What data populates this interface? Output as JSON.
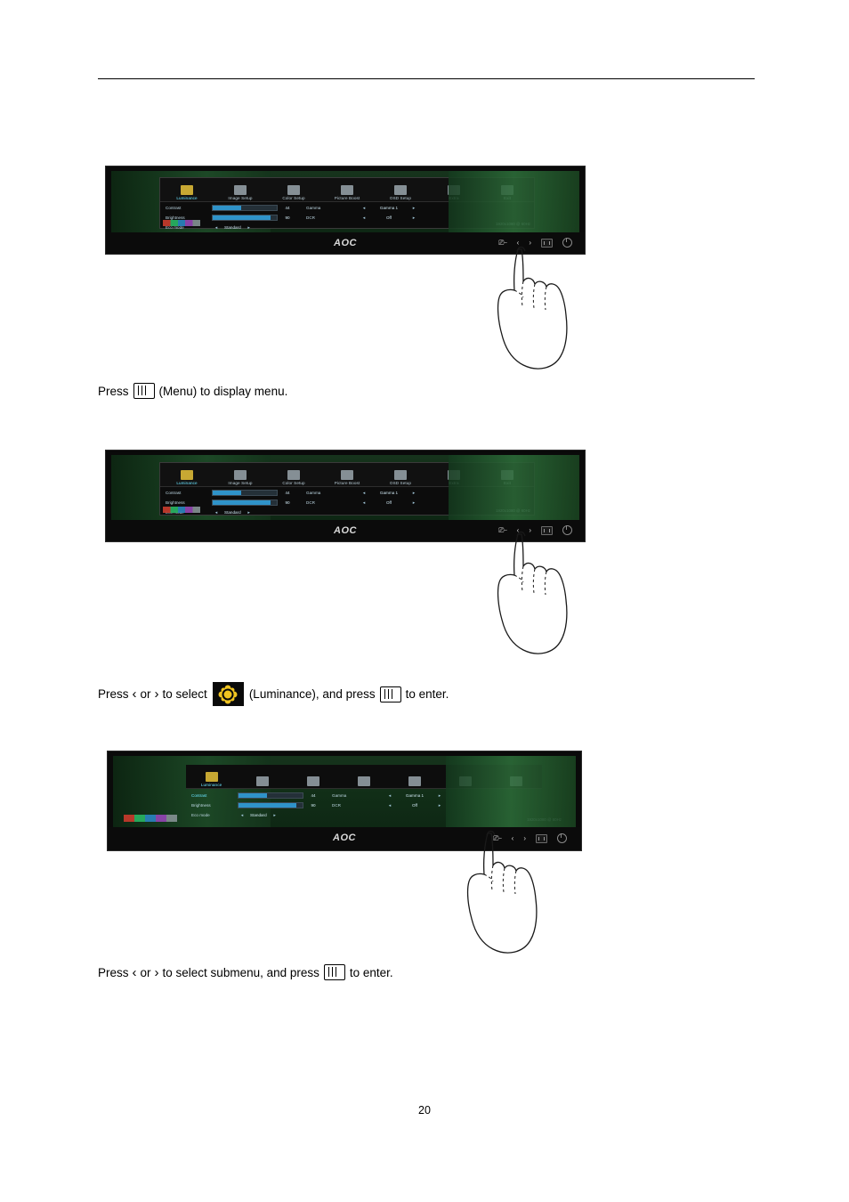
{
  "page": {
    "number": "20"
  },
  "osd": {
    "tabs": [
      {
        "label": "Luminance",
        "icon": "brightness-icon"
      },
      {
        "label": "Image Setup",
        "icon": "image-setup-icon"
      },
      {
        "label": "Color Setup",
        "icon": "color-setup-icon"
      },
      {
        "label": "Picture Boost",
        "icon": "picture-boost-icon"
      },
      {
        "label": "OSD Setup",
        "icon": "osd-setup-icon"
      },
      {
        "label": "Extra",
        "icon": "extra-icon"
      },
      {
        "label": "Exit",
        "icon": "exit-icon"
      }
    ],
    "rows": [
      {
        "name": "Contrast",
        "value": "44",
        "bar": 44,
        "name2": "Gamma",
        "option": "Gamma 1"
      },
      {
        "name": "Brightness",
        "value": "90",
        "bar": 90,
        "name2": "DCR",
        "option": "Off"
      }
    ],
    "eco": {
      "name": "Eco mode",
      "value": "Standard"
    },
    "resolution": "1920x1080 @ 60Hz"
  },
  "figures": [
    {
      "id": "figure-1",
      "caption_parts": {
        "pre": "Press",
        "key": "menu-key-icon",
        "post": "(Menu) to display menu."
      }
    },
    {
      "id": "figure-2",
      "caption_parts": {
        "pre": "Press",
        "left": "‹",
        "or": "or",
        "right": "›",
        "mid": "to select",
        "icon": "luminance-icon",
        "mid2": "(Luminance), and press",
        "key": "menu-key-icon",
        "post": "to enter."
      }
    },
    {
      "id": "figure-3",
      "caption_parts": {
        "pre": "Press",
        "left": "‹",
        "or": "or",
        "right": "›",
        "mid": "to select submenu, and press",
        "key": "menu-key-icon",
        "post": "to enter."
      }
    }
  ],
  "monitor": {
    "brand": "AOC",
    "buttons": [
      {
        "name": "source-button",
        "glyph": "⌨"
      },
      {
        "name": "left-button",
        "glyph": "‹"
      },
      {
        "name": "right-button",
        "glyph": "›"
      },
      {
        "name": "menu-button",
        "glyph": "menu"
      },
      {
        "name": "power-button",
        "glyph": "power"
      }
    ]
  }
}
